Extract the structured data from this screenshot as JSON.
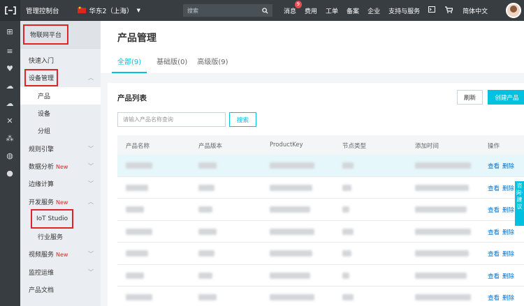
{
  "topbar": {
    "console_label": "管理控制台",
    "region_label": "华东2（上海）",
    "search_placeholder": "搜索",
    "nav": [
      "消息",
      "费用",
      "工单",
      "备案",
      "企业",
      "支持与服务"
    ],
    "message_badge": "9",
    "language": "简体中文"
  },
  "leftnav": {
    "platform_title": "物联网平台",
    "quick_start": "快速入门",
    "device_mgmt": "设备管理",
    "sub_product": "产品",
    "sub_device": "设备",
    "sub_group": "分组",
    "rule_engine": "规则引擎",
    "data_analysis": "数据分析",
    "edge_computing": "边缘计算",
    "dev_services": "开发服务",
    "iot_studio": "IoT Studio",
    "industry_services": "行业服务",
    "video_services": "视频服务",
    "monitoring": "监控运维",
    "product_docs": "产品文档",
    "new_tag": "New"
  },
  "main": {
    "page_title": "产品管理",
    "tabs": [
      "全部(9)",
      "基础版(0)",
      "高级版(9)"
    ],
    "list_title": "产品列表",
    "refresh_label": "刷新",
    "create_label": "创建产品",
    "query_placeholder": "请输入产品名称查询",
    "search_button": "搜索",
    "columns": [
      "产品名称",
      "产品版本",
      "ProductKey",
      "节点类型",
      "添加时间",
      "操作"
    ],
    "row_action_view": "查看",
    "row_action_delete": "删除",
    "row_count": 7
  },
  "feedback_label": "咨询·建议",
  "colors": {
    "accent": "#00c1de",
    "topbar": "#373d41",
    "highlight": "#e02424"
  }
}
